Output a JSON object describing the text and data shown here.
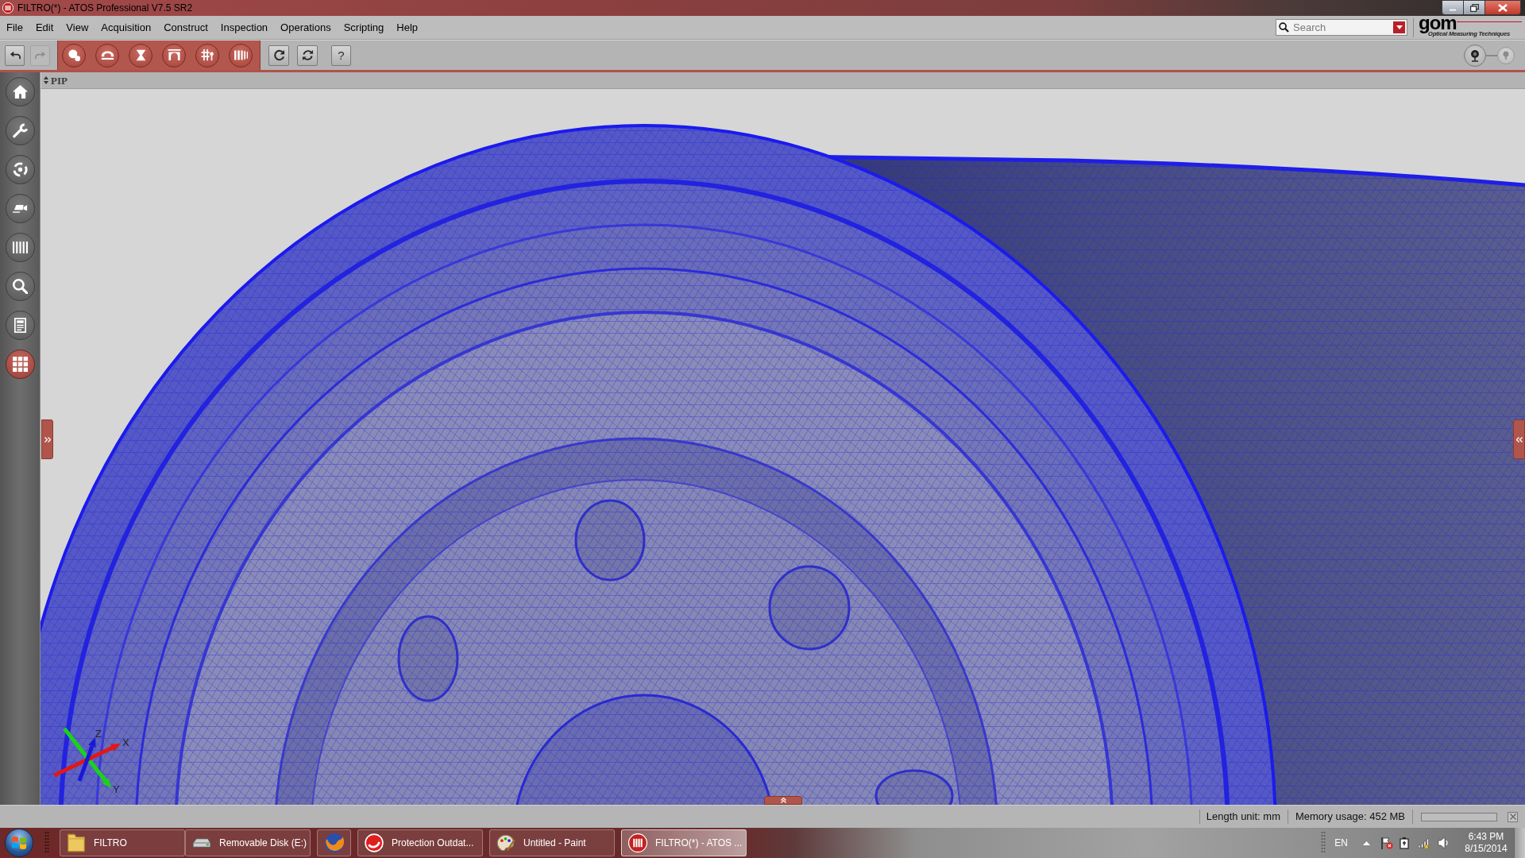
{
  "window": {
    "title": "FILTRO(*) - ATOS Professional V7.5 SR2"
  },
  "menu": [
    "File",
    "Edit",
    "View",
    "Acquisition",
    "Construct",
    "Inspection",
    "Operations",
    "Scripting",
    "Help"
  ],
  "search": {
    "placeholder": "Search"
  },
  "logo": {
    "wordmark": "gom",
    "tagline": "Optical Measuring Techniques"
  },
  "toolbar": {
    "history": [
      {
        "kind": "undo",
        "disabled": false
      },
      {
        "kind": "redo",
        "disabled": true
      }
    ],
    "workflow": [
      {
        "kind": "points"
      },
      {
        "kind": "bridge"
      },
      {
        "kind": "hourglass"
      },
      {
        "kind": "arch"
      },
      {
        "kind": "tools"
      },
      {
        "kind": "bars"
      }
    ],
    "refresh": [
      {
        "kind": "refresh"
      },
      {
        "kind": "sync"
      }
    ],
    "help": "?"
  },
  "view": {
    "panel_title": "PIP",
    "axes": {
      "x": "X",
      "y": "Y",
      "z": "Z"
    }
  },
  "sidebar": {
    "items": [
      {
        "kind": "home",
        "selected": false
      },
      {
        "kind": "wrench",
        "selected": false
      },
      {
        "kind": "orbit",
        "selected": false
      },
      {
        "kind": "camera",
        "selected": false
      },
      {
        "kind": "bars",
        "selected": false
      },
      {
        "kind": "search",
        "selected": false
      },
      {
        "kind": "document",
        "selected": false
      },
      {
        "kind": "grid",
        "selected": true
      }
    ]
  },
  "status_bar": {
    "length_unit": "Length unit: mm",
    "memory": "Memory usage: 452 MB"
  },
  "taskbar": {
    "items": [
      {
        "kind": "folder",
        "label": "FILTRO",
        "selected": false
      },
      {
        "kind": "drive",
        "label": "Removable Disk (E:)",
        "selected": false
      },
      {
        "kind": "browser",
        "selected": false
      },
      {
        "kind": "antivirus",
        "label": "Protection Outdat...",
        "selected": false
      },
      {
        "kind": "paint",
        "label": "Untitled - Paint",
        "selected": false
      },
      {
        "kind": "atos",
        "label": "FILTRO(*) - ATOS ...",
        "selected": true
      }
    ],
    "tray": {
      "language": "EN",
      "time": "6:43 PM",
      "date": "8/15/2014"
    }
  }
}
